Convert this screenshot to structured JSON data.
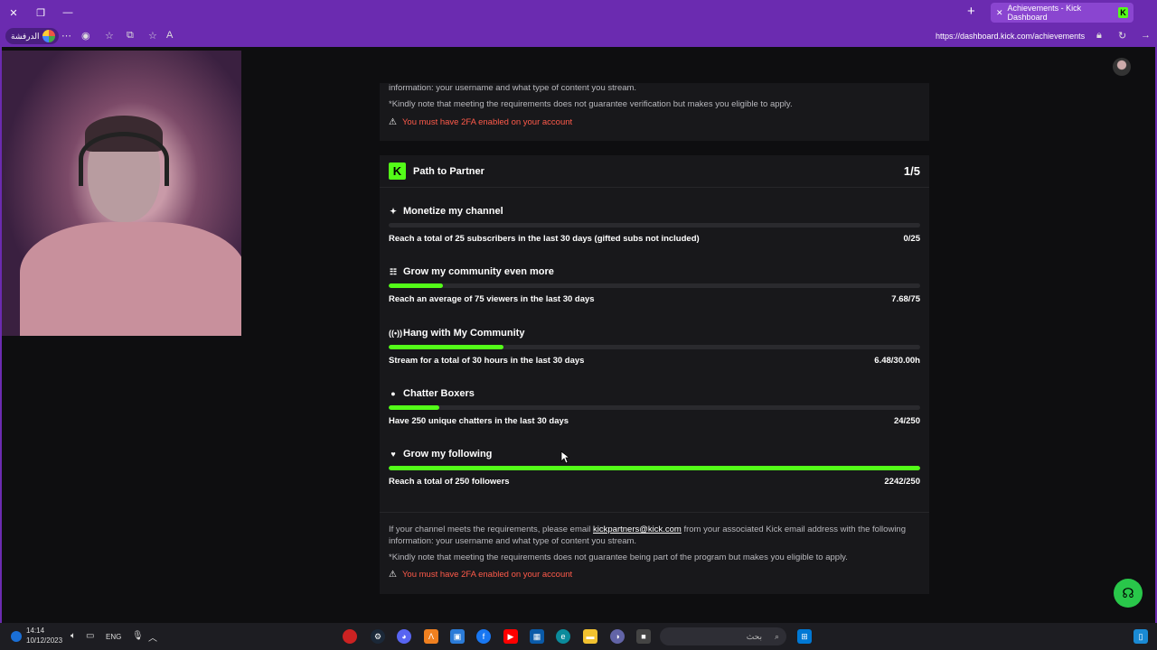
{
  "browser": {
    "tab_title": "Achievements - Kick Dashboard",
    "url": "https://dashboard.kick.com/achievements",
    "profile_label": "الدرفشة",
    "new_tab_symbol": "+",
    "tab_close_symbol": "✕"
  },
  "verification_card": {
    "line1": "information: your username and what type of content you stream.",
    "note": "*Kindly note that meeting the requirements does not guarantee verification but makes you eligible to apply.",
    "warning": "You must have 2FA enabled on your account"
  },
  "partner_card": {
    "logo_letter": "K",
    "title": "Path to Partner",
    "count": "1/5",
    "goals": [
      {
        "icon": "sparkle-icon",
        "glyph": "✦",
        "title": "Monetize my channel",
        "desc": "Reach a total of 25 subscribers in the last 30 days (gifted subs not included)",
        "value": "0/25",
        "progress": 0
      },
      {
        "icon": "community-icon",
        "glyph": "☷",
        "title": "Grow my community even more",
        "desc": "Reach an average of 75 viewers in the last 30 days",
        "value": "7.68/75",
        "progress": 0.1024
      },
      {
        "icon": "broadcast-icon",
        "glyph": "((•))",
        "title": "Hang with My Community",
        "desc": "Stream for a total of 30 hours in the last 30 days",
        "value": "6.48/30.00h",
        "progress": 0.216
      },
      {
        "icon": "chat-icon",
        "glyph": "●",
        "title": "Chatter Boxers",
        "desc": "Have 250 unique chatters in the last 30 days",
        "value": "24/250",
        "progress": 0.096
      },
      {
        "icon": "heart-icon",
        "glyph": "♥",
        "title": "Grow my following",
        "desc": "Reach a total of 250 followers",
        "value": "2242/250",
        "progress": 1
      }
    ],
    "footer": {
      "text_before": "If your channel meets the requirements, please email ",
      "email": "kickpartners@kick.com",
      "text_after": " from your associated Kick email address with the following information: your username and what type of content you stream.",
      "note": "*Kindly note that meeting the requirements does not guarantee being part of the program but makes you eligible to apply.",
      "warning": "You must have 2FA enabled on your account"
    }
  },
  "taskbar": {
    "time": "14:14",
    "date": "10/12/2023",
    "language": "ENG",
    "search_placeholder": "بحث"
  },
  "colors": {
    "kick_green": "#53fc18",
    "browser_purple": "#6b2bb0",
    "warning_red": "#ff5a4a"
  }
}
